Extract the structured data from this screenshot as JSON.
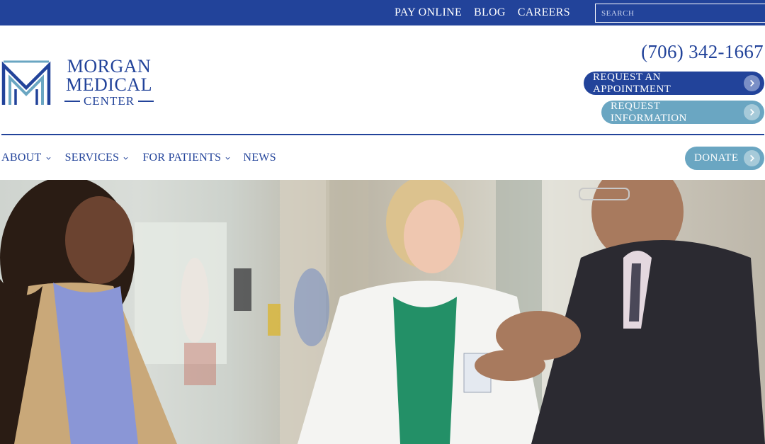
{
  "topbar": {
    "links": [
      "PAY ONLINE",
      "BLOG",
      "CAREERS"
    ],
    "search_placeholder": "SEARCH"
  },
  "logo": {
    "line1": "MORGAN",
    "line2": "MEDICAL",
    "line3": "CENTER"
  },
  "header": {
    "phone": "(706) 342-1667",
    "request_appointment": "REQUEST AN APPOINTMENT",
    "request_information": "REQUEST INFORMATION"
  },
  "nav": {
    "items": [
      "ABOUT",
      "SERVICES",
      "FOR PATIENTS",
      "NEWS"
    ],
    "donate": "DONATE"
  },
  "colors": {
    "brand_blue": "#22439a",
    "accent_teal": "#6aa6c2",
    "white": "#ffffff"
  },
  "hero": {
    "image": "Photo of three people smiling and talking in a hospital hallway: a woman in a tan cardigan, a blonde woman in a white lab coat with a green top, and a man in a dark suit and glasses gesturing."
  }
}
